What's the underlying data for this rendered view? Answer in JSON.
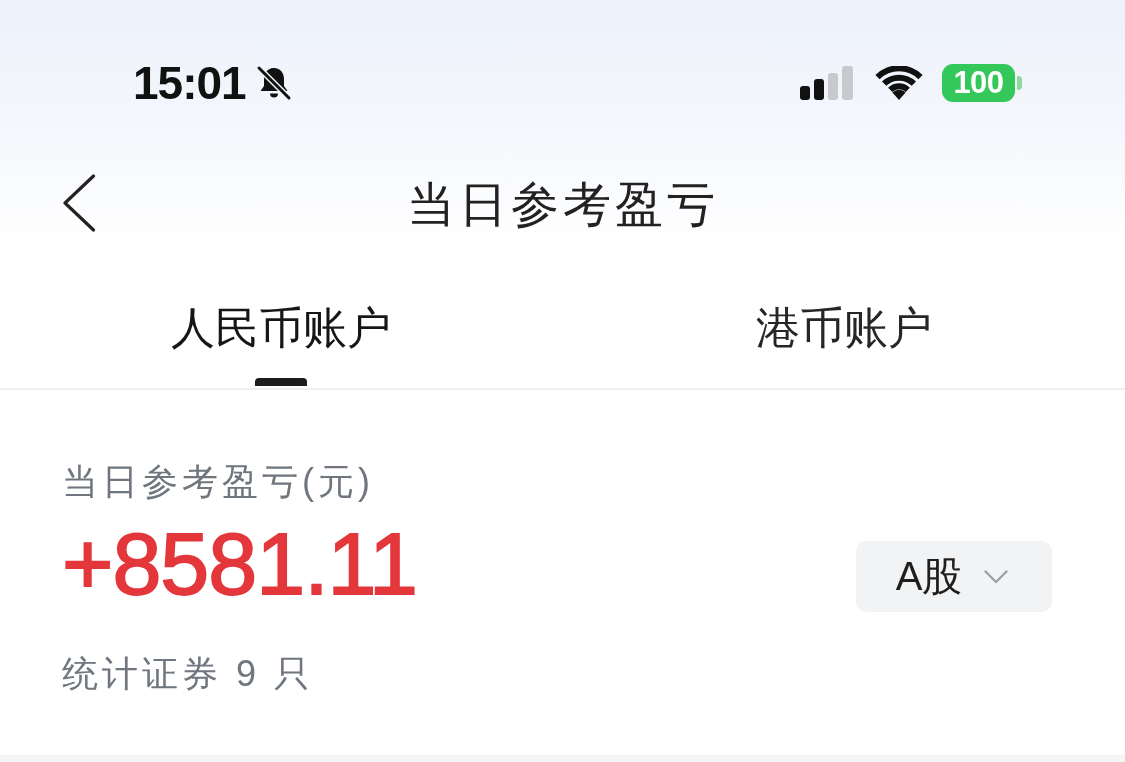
{
  "status_bar": {
    "time": "15:01",
    "silent": true,
    "battery": "100"
  },
  "nav_bar": {
    "title": "当日参考盈亏"
  },
  "tabs": [
    {
      "label": "人民币账户",
      "selected": true
    },
    {
      "label": "港币账户",
      "selected": false
    }
  ],
  "summary": {
    "label": "当日参考盈亏(元)",
    "value": "+8581.11",
    "market_select": {
      "value": "A股"
    },
    "count_text": "统计证券 9 只"
  }
}
